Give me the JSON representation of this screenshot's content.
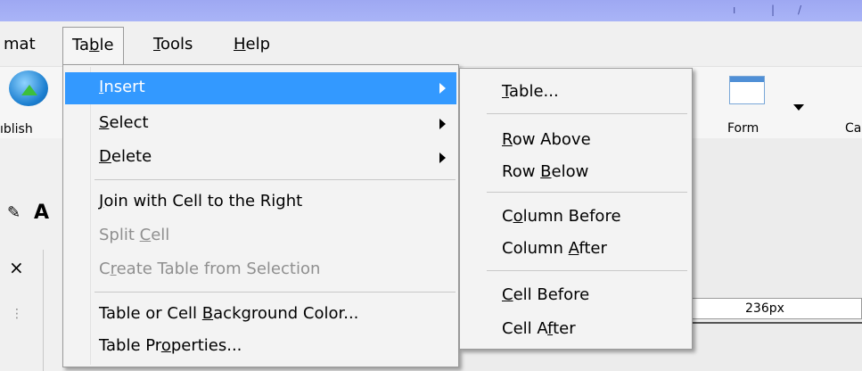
{
  "menubar": {
    "items": [
      {
        "label": "mat",
        "underline": ""
      },
      {
        "label": "Table",
        "underline": "b"
      },
      {
        "label": "Tools",
        "underline": "T"
      },
      {
        "label": "Help",
        "underline": "H"
      }
    ]
  },
  "toolbar": {
    "publish_label": "ıblish",
    "form_label": "Form",
    "cut_label": "Ca"
  },
  "table_menu": {
    "items": [
      {
        "label": "Insert",
        "state": "active",
        "submenu": true
      },
      {
        "label": "Select",
        "state": "normal",
        "submenu": true
      },
      {
        "label": "Delete",
        "state": "normal",
        "submenu": true
      },
      {
        "label": "Join with Cell to the Right",
        "state": "normal"
      },
      {
        "label": "Split Cell",
        "state": "disabled"
      },
      {
        "label": "Create Table from Selection",
        "state": "disabled"
      },
      {
        "label": "Table or Cell Background Color...",
        "state": "normal"
      },
      {
        "label": "Table Properties...",
        "state": "normal"
      }
    ]
  },
  "insert_submenu": {
    "items": [
      {
        "label": "Table..."
      },
      {
        "label": "Row Above"
      },
      {
        "label": "Row Below"
      },
      {
        "label": "Column Before"
      },
      {
        "label": "Column After"
      },
      {
        "label": "Cell Before"
      },
      {
        "label": "Cell After"
      }
    ]
  },
  "content": {
    "width_readout": "236px"
  },
  "colors": {
    "highlight": "#3399ff",
    "titlebar": "#a2acf4",
    "disabled_text": "#8f8f8f"
  }
}
